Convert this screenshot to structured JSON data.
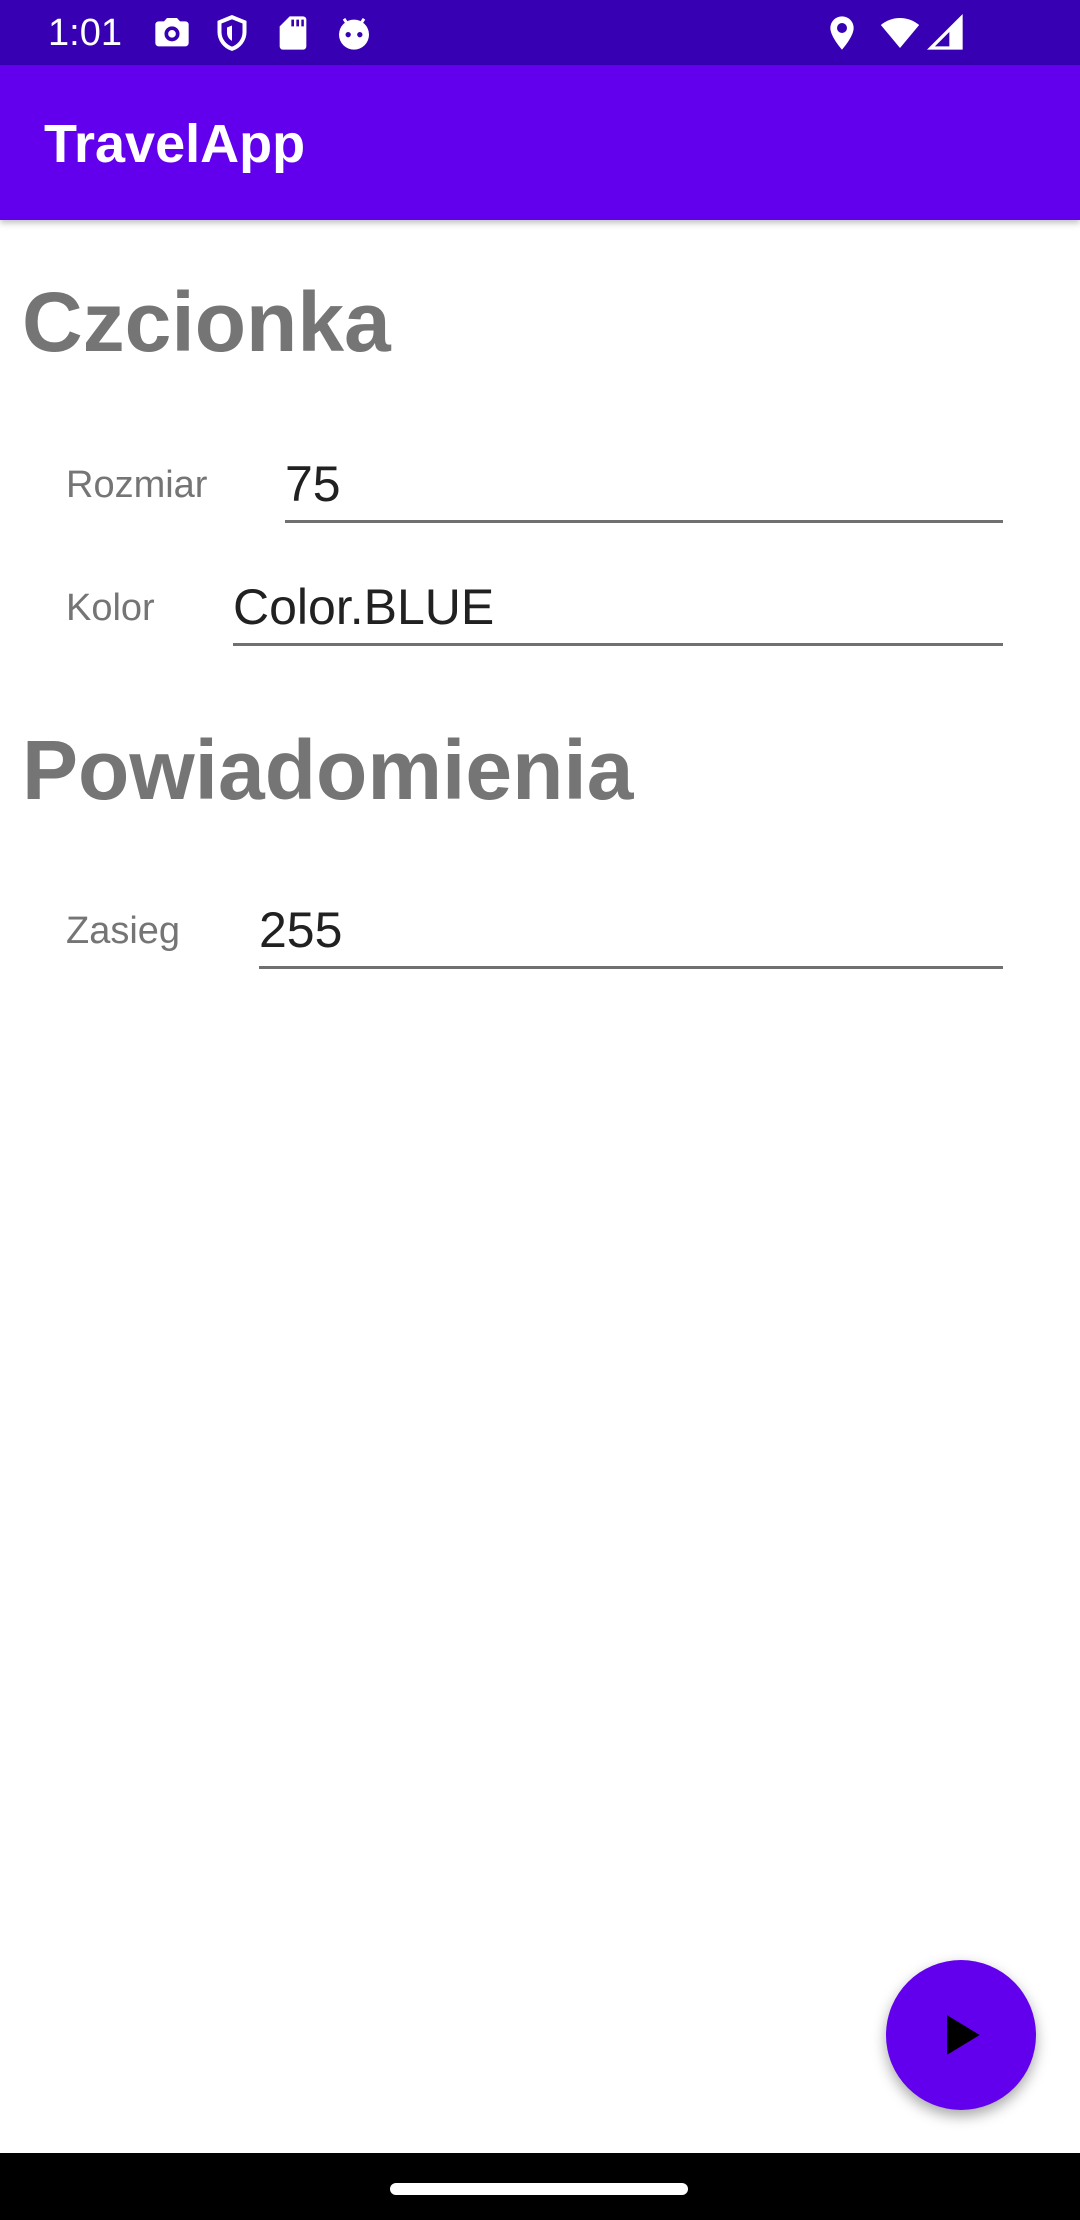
{
  "status_bar": {
    "time": "1:01",
    "left_icons": [
      "camera-icon",
      "shield-icon",
      "sd-card-icon",
      "android-debug-icon"
    ],
    "right_icons": [
      "location-pin-icon",
      "wifi-icon",
      "signal-icon"
    ]
  },
  "app_bar": {
    "title": "TravelApp",
    "background": "#6200ee"
  },
  "sections": {
    "font": {
      "title": "Czcionka",
      "size_label": "Rozmiar",
      "size_value": "75",
      "color_label": "Kolor",
      "color_value": "Color.BLUE"
    },
    "notifications": {
      "title": "Powiadomienia",
      "range_label": "Zasieg",
      "range_value": "255"
    }
  },
  "fab": {
    "icon": "play-icon",
    "color": "#6200ee"
  },
  "colors": {
    "status_bar": "#3700b3",
    "accent": "#6200ee",
    "section_title": "#757575",
    "input_text": "#212121"
  }
}
